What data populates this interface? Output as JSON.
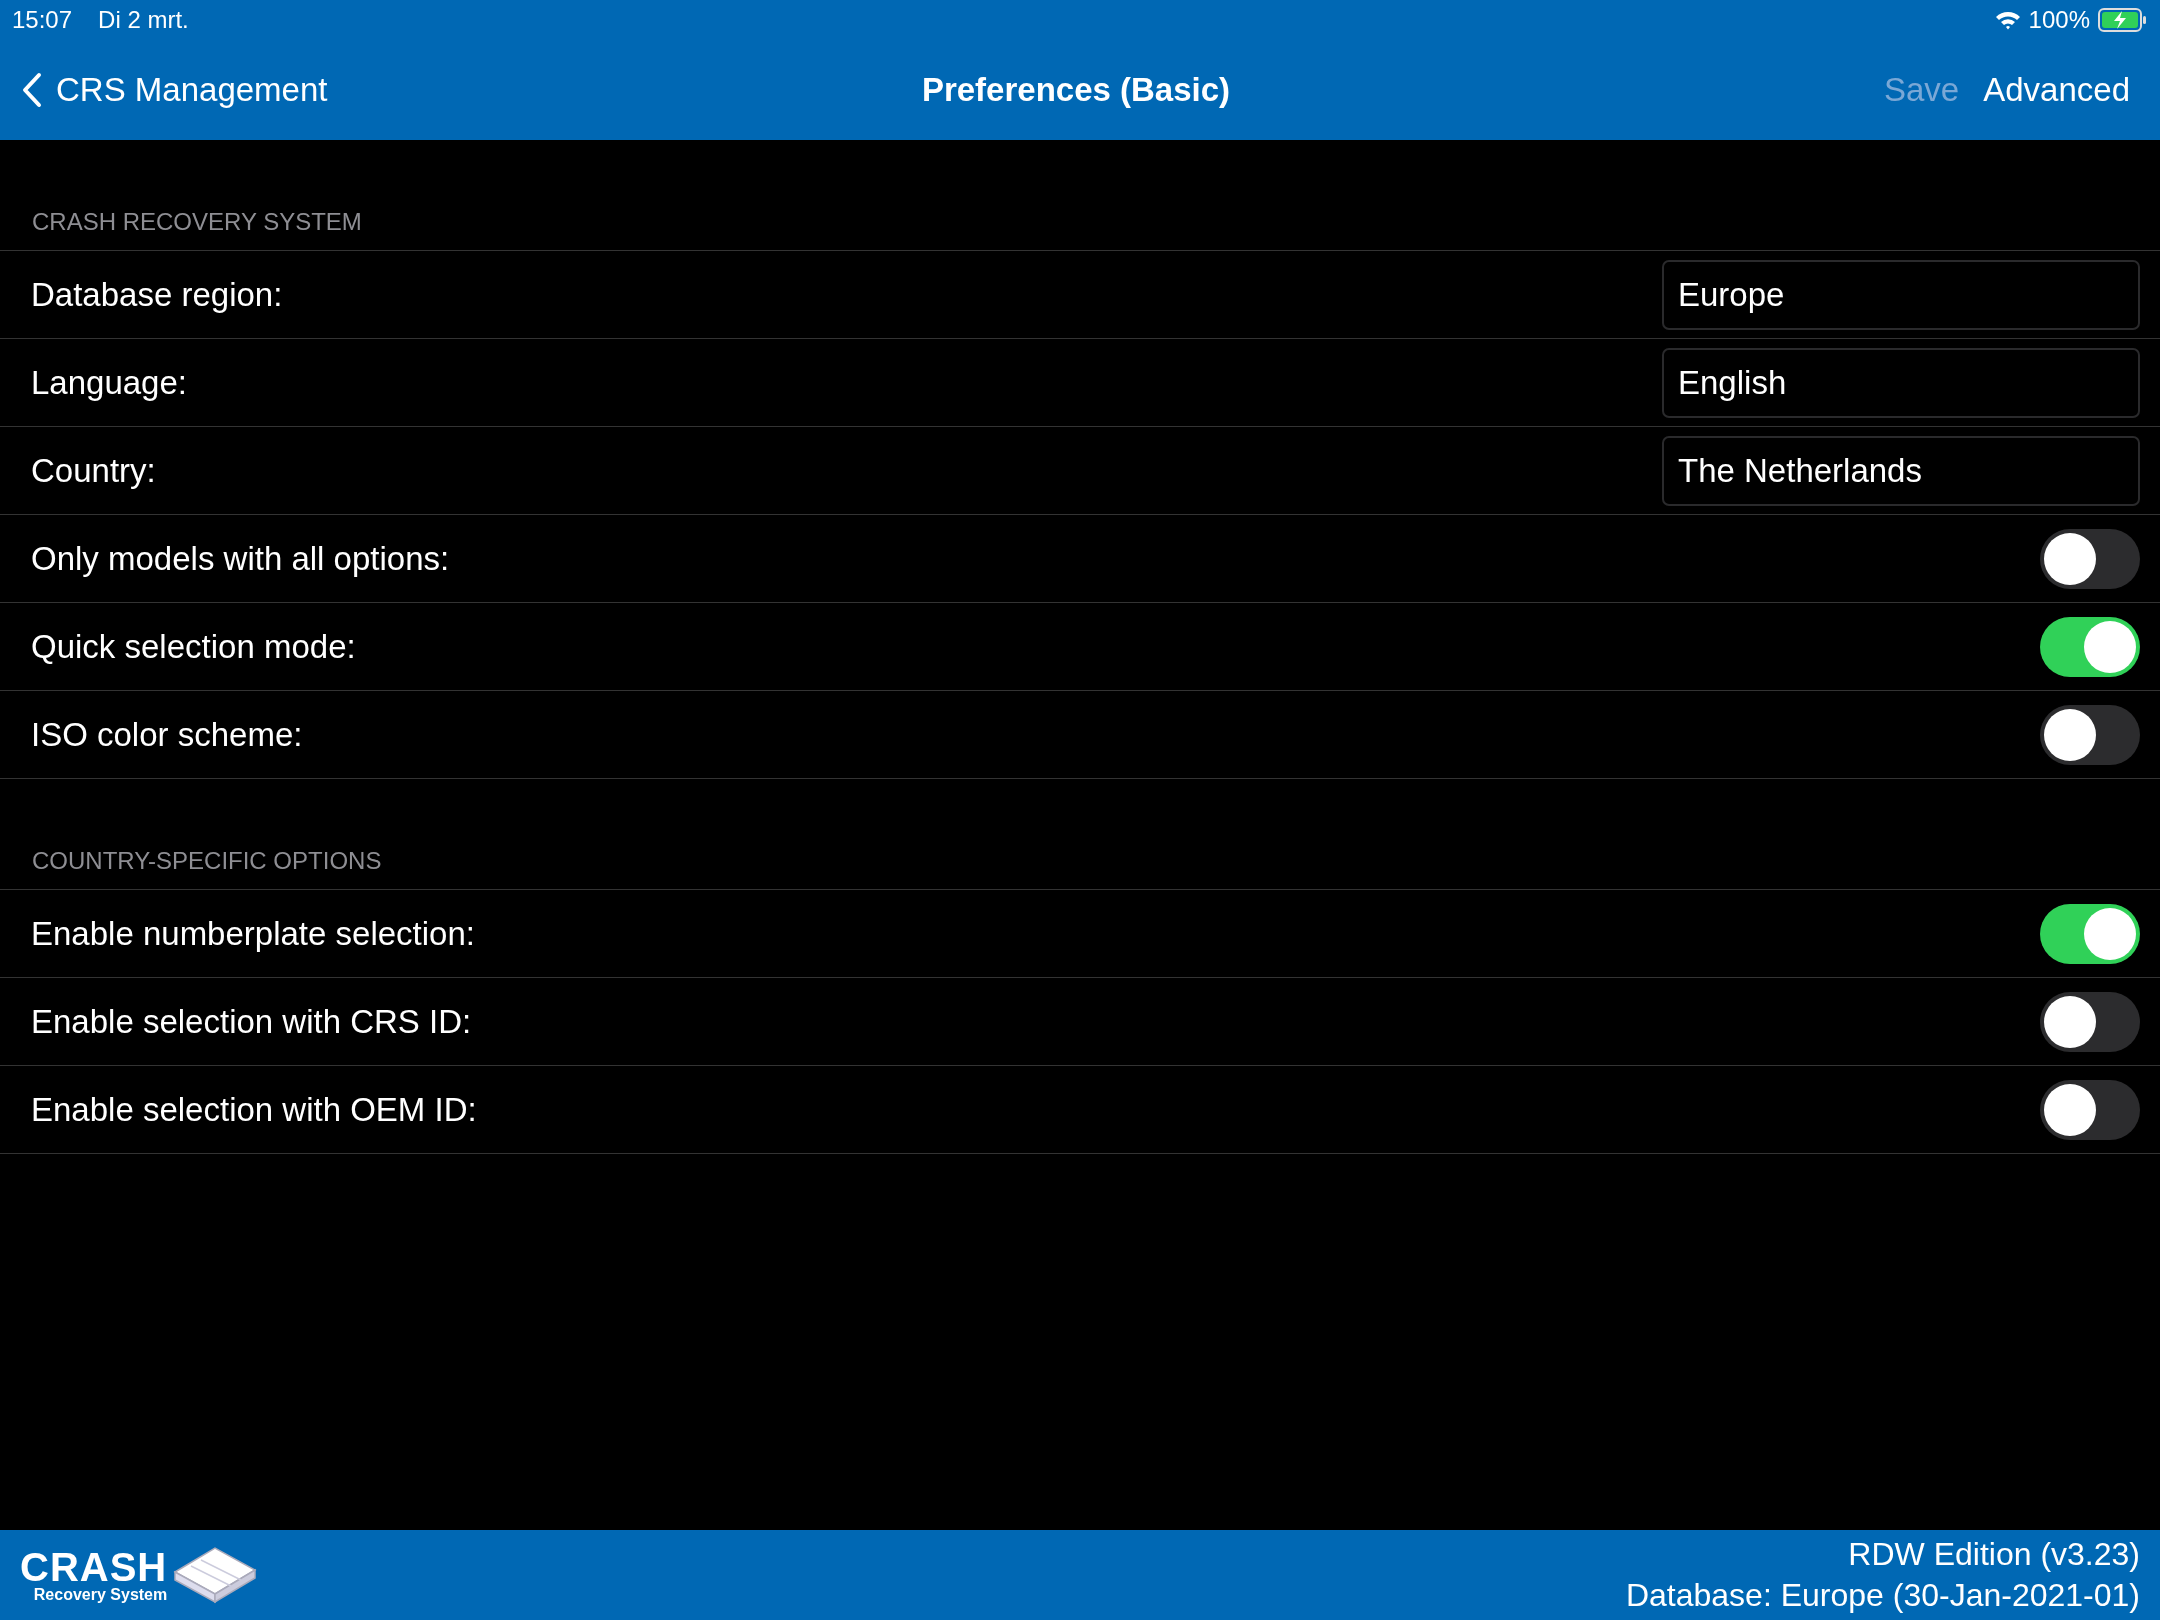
{
  "status_bar": {
    "time": "15:07",
    "date": "Di 2 mrt.",
    "battery": "100%"
  },
  "nav_bar": {
    "back": "CRS Management",
    "title": "Preferences (Basic)",
    "actions": [
      {
        "label": "Save",
        "disabled": true
      },
      {
        "label": "Advanced",
        "disabled": false
      }
    ]
  },
  "sections": [
    {
      "header": "CRASH RECOVERY SYSTEM",
      "rows": [
        {
          "kind": "field",
          "label": "Database region:",
          "value": "Europe"
        },
        {
          "kind": "field",
          "label": "Language:",
          "value": "English"
        },
        {
          "kind": "field",
          "label": "Country:",
          "value": "The Netherlands"
        },
        {
          "kind": "toggle",
          "label": "Only models with all options:",
          "on": false
        },
        {
          "kind": "toggle",
          "label": "Quick selection mode:",
          "on": true
        },
        {
          "kind": "toggle",
          "label": "ISO color scheme:",
          "on": false
        }
      ]
    },
    {
      "header": "COUNTRY-SPECIFIC OPTIONS",
      "rows": [
        {
          "kind": "toggle",
          "label": "Enable numberplate selection:",
          "on": true
        },
        {
          "kind": "toggle",
          "label": "Enable selection with CRS ID:",
          "on": false
        },
        {
          "kind": "toggle",
          "label": "Enable selection with OEM ID:",
          "on": false
        }
      ]
    }
  ],
  "footer": {
    "logo": {
      "title": "CRASH",
      "subtitle": "Recovery System"
    },
    "edition": "RDW Edition (v3.23)",
    "database": "Database: Europe (30-Jan-2021-01)"
  }
}
